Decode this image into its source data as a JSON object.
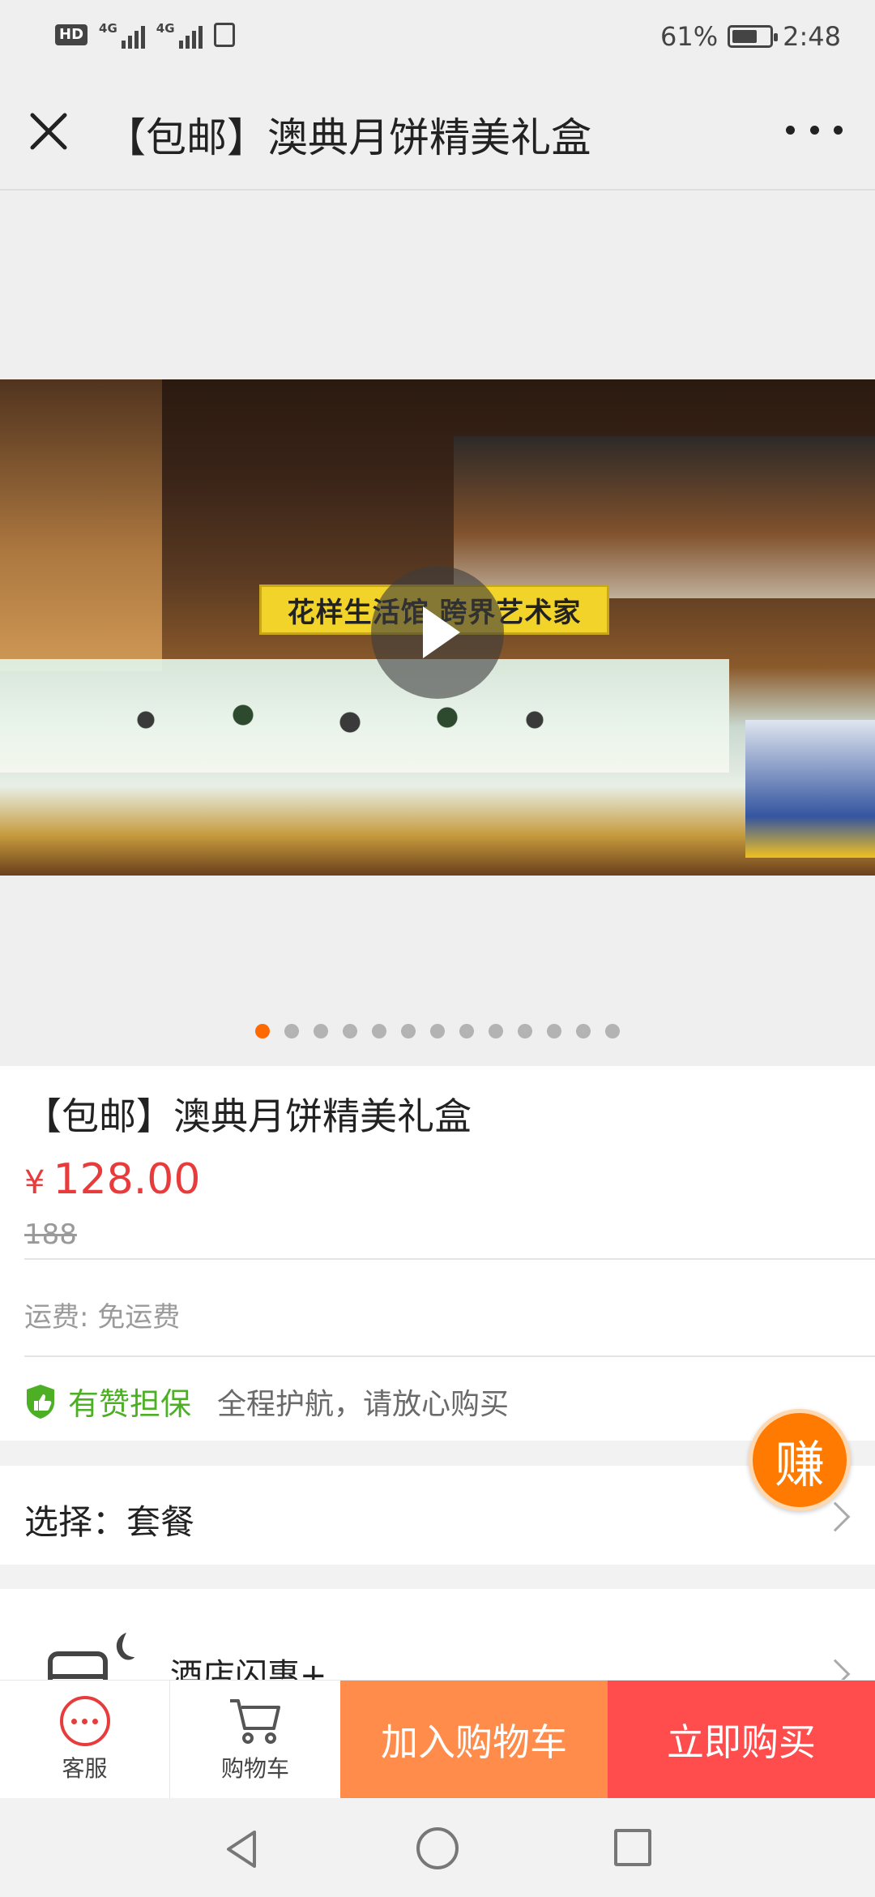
{
  "status_bar": {
    "hd": "HD",
    "network_1": "4G",
    "network_2": "4G",
    "battery_percent": "61%",
    "time": "2:48"
  },
  "header": {
    "title": "【包邮】澳典月饼精美礼盒"
  },
  "media": {
    "video_banner": "花样生活馆 跨界艺术家",
    "slide_count": 13,
    "active_slide": 1
  },
  "product": {
    "title": "【包邮】澳典月饼精美礼盒",
    "currency": "¥",
    "price": "128.00",
    "original_price": "188",
    "shipping": "运费: 免运费",
    "guarantee_name": "有赞担保",
    "guarantee_desc": "全程护航，请放心购买"
  },
  "select": {
    "label": "选择：套餐"
  },
  "hotel": {
    "label": "酒店闪惠+"
  },
  "earn_button": "赚",
  "actions": {
    "customer_service": "客服",
    "cart": "购物车",
    "add_to_cart": "加入购物车",
    "buy_now": "立即购买"
  },
  "colors": {
    "price_red": "#e83c3c",
    "accent_orange": "#ff6a00",
    "guarantee_green": "#4caf24",
    "add_cart_bg": "#ff8c4a",
    "buy_now_bg": "#ff4c4c"
  }
}
